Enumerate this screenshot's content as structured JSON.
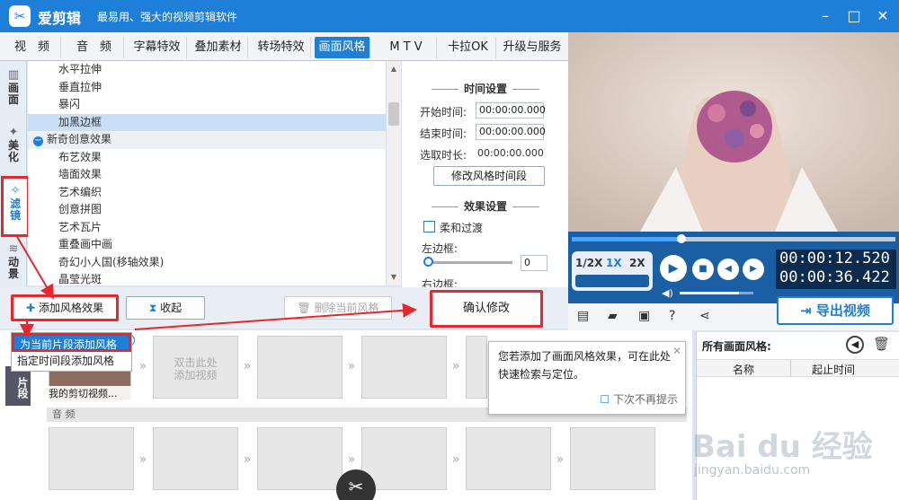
{
  "app": {
    "title": "爱剪辑",
    "subtitle": "最易用、强大的视频剪辑软件",
    "logo": "app-logo-icon"
  },
  "window": {
    "minimize": "–",
    "maximize": "□",
    "close": "✕"
  },
  "tabs": [
    "视　频",
    "音　频",
    "字幕特效",
    "叠加素材",
    "转场特效",
    "画面风格",
    "M T V",
    "卡拉OK",
    "升级与服务"
  ],
  "active_tab": "画面风格",
  "side_tabs": [
    {
      "label": "画面",
      "icon": "panel-icon"
    },
    {
      "label": "美化",
      "icon": "wand-icon"
    },
    {
      "label": "滤镜",
      "icon": "magic-icon"
    },
    {
      "label": "动景",
      "icon": "wave-icon"
    }
  ],
  "list_items": [
    {
      "label": "水平拉伸",
      "type": "item"
    },
    {
      "label": "垂直拉伸",
      "type": "item"
    },
    {
      "label": "暴闪",
      "type": "item"
    },
    {
      "label": "加黑边框",
      "type": "selected"
    },
    {
      "label": "新奇创意效果",
      "type": "group"
    },
    {
      "label": "布艺效果",
      "type": "item"
    },
    {
      "label": "墙面效果",
      "type": "item"
    },
    {
      "label": "艺术编织",
      "type": "item"
    },
    {
      "label": "创意拼图",
      "type": "item"
    },
    {
      "label": "艺术瓦片",
      "type": "item"
    },
    {
      "label": "重叠画中画",
      "type": "item"
    },
    {
      "label": "奇幻小人国(移轴效果)",
      "type": "item"
    },
    {
      "label": "晶莹光斑",
      "type": "item"
    }
  ],
  "time_settings": {
    "header": "时间设置",
    "start_label": "开始时间:",
    "start_value": "00:00:00.000",
    "end_label": "结束时间:",
    "end_value": "00:00:00.000",
    "duration_label": "选取时长:",
    "duration_value": "00:00:00.000",
    "modify_button": "修改风格时间段"
  },
  "effect_settings": {
    "header": "效果设置",
    "soft_label": "柔和过渡",
    "left_border_label": "左边框:",
    "left_border_value": "0",
    "right_border_label": "右边框:"
  },
  "buttons": {
    "add_style": "添加风格效果",
    "collapse": "收起",
    "delete_style": "删除当前风格",
    "confirm": "确认修改"
  },
  "popup_menu": [
    "为当前片段添加风格",
    "指定时间段添加风格"
  ],
  "player": {
    "speeds": [
      "1/2X",
      "1X",
      "2X"
    ],
    "active_speed": "1X",
    "time_current": "00:00:12.520",
    "time_total": "00:00:36.422",
    "progress": 0.34,
    "volume": 0.8
  },
  "tools": [
    "new-icon",
    "folder-icon",
    "save-icon",
    "help-icon",
    "share-icon"
  ],
  "export_button": "导出视频",
  "timeline": {
    "side_label": "片段",
    "clip_name": "我的剪切视频...",
    "empty_hint": "双击此处\n添加视频",
    "audio_label": "音 频"
  },
  "tip": {
    "text": "您若添加了画面风格效果，可在此处快速检索与定位。",
    "no_show": "下次不再提示",
    "close": "✕"
  },
  "right_panel": {
    "title": "所有画面风格:",
    "col_name": "名称",
    "col_time": "起止时间"
  },
  "watermark": {
    "logo": "Bai du 经验",
    "url": "jingyan.baidu.com"
  },
  "colors": {
    "accent": "#1e7fd9",
    "highlight": "#e8262b"
  }
}
